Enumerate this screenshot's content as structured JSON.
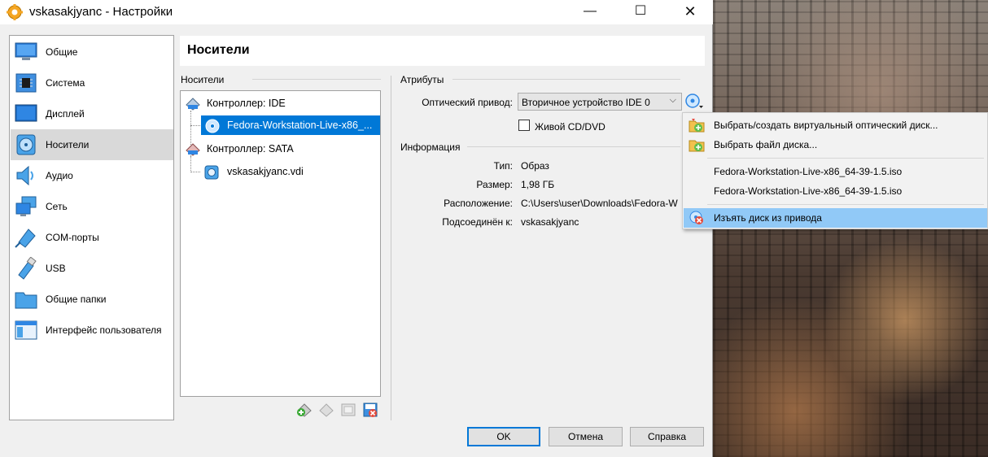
{
  "window": {
    "title": "vskasakjyanc - Настройки",
    "controls": {
      "minimize": "—",
      "maximize": "☐",
      "close": "✕"
    }
  },
  "sidebar": {
    "items": [
      {
        "label": "Общие",
        "icon": "general-monitor-icon",
        "selected": false
      },
      {
        "label": "Система",
        "icon": "system-chip-icon",
        "selected": false
      },
      {
        "label": "Дисплей",
        "icon": "display-icon",
        "selected": false
      },
      {
        "label": "Носители",
        "icon": "storage-disc-icon",
        "selected": true
      },
      {
        "label": "Аудио",
        "icon": "audio-speaker-icon",
        "selected": false
      },
      {
        "label": "Сеть",
        "icon": "network-icon",
        "selected": false
      },
      {
        "label": "COM-порты",
        "icon": "serial-port-icon",
        "selected": false
      },
      {
        "label": "USB",
        "icon": "usb-icon",
        "selected": false
      },
      {
        "label": "Общие папки",
        "icon": "shared-folder-icon",
        "selected": false
      },
      {
        "label": "Интерфейс пользователя",
        "icon": "user-interface-icon",
        "selected": false
      }
    ]
  },
  "page": {
    "title": "Носители"
  },
  "storage": {
    "group_title": "Носители",
    "tree": [
      {
        "label": "Контроллер: IDE",
        "icon": "ide-controller-icon",
        "level": 0
      },
      {
        "label": "Fedora-Workstation-Live-x86_...",
        "icon": "optical-disc-icon",
        "level": 1,
        "selected": true
      },
      {
        "label": "Контроллер: SATA",
        "icon": "sata-controller-icon",
        "level": 0
      },
      {
        "label": "vskasakjyanc.vdi",
        "icon": "hard-disk-icon",
        "level": 1
      }
    ],
    "toolbar": [
      "add-controller-icon",
      "remove-controller-icon",
      "add-attachment-icon",
      "remove-attachment-icon"
    ]
  },
  "attributes": {
    "group_title": "Атрибуты",
    "optical_drive_label": "Оптический привод:",
    "optical_drive_value": "Вторичное устройство IDE 0",
    "live_cd_label": "Живой CD/DVD",
    "live_cd_checked": false
  },
  "information": {
    "group_title": "Информация",
    "rows": [
      {
        "label": "Тип:",
        "value": "Образ"
      },
      {
        "label": "Размер:",
        "value": "1,98 ГБ"
      },
      {
        "label": "Расположение:",
        "value": "C:\\Users\\user\\Downloads\\Fedora-W"
      },
      {
        "label": "Подсоединён к:",
        "value": "vskasakjyanc"
      }
    ]
  },
  "disc_menu": {
    "items": [
      {
        "label": "Выбрать/создать виртуальный оптический диск...",
        "icon": "choose-create-disc-icon"
      },
      {
        "label": "Выбрать файл диска...",
        "icon": "choose-disk-file-icon"
      },
      {
        "label": "Fedora-Workstation-Live-x86_64-39-1.5.iso",
        "icon": ""
      },
      {
        "label": "Fedora-Workstation-Live-x86_64-39-1.5.iso",
        "icon": ""
      },
      {
        "label": "Изъять диск из привода",
        "icon": "eject-disk-icon",
        "highlighted": true
      }
    ]
  },
  "buttons": {
    "ok": "OK",
    "cancel": "Отмена",
    "help": "Справка"
  },
  "colors": {
    "selection": "#0078d7",
    "menu_highlight": "#91c9f7",
    "side_selected": "#d9d9d9"
  }
}
